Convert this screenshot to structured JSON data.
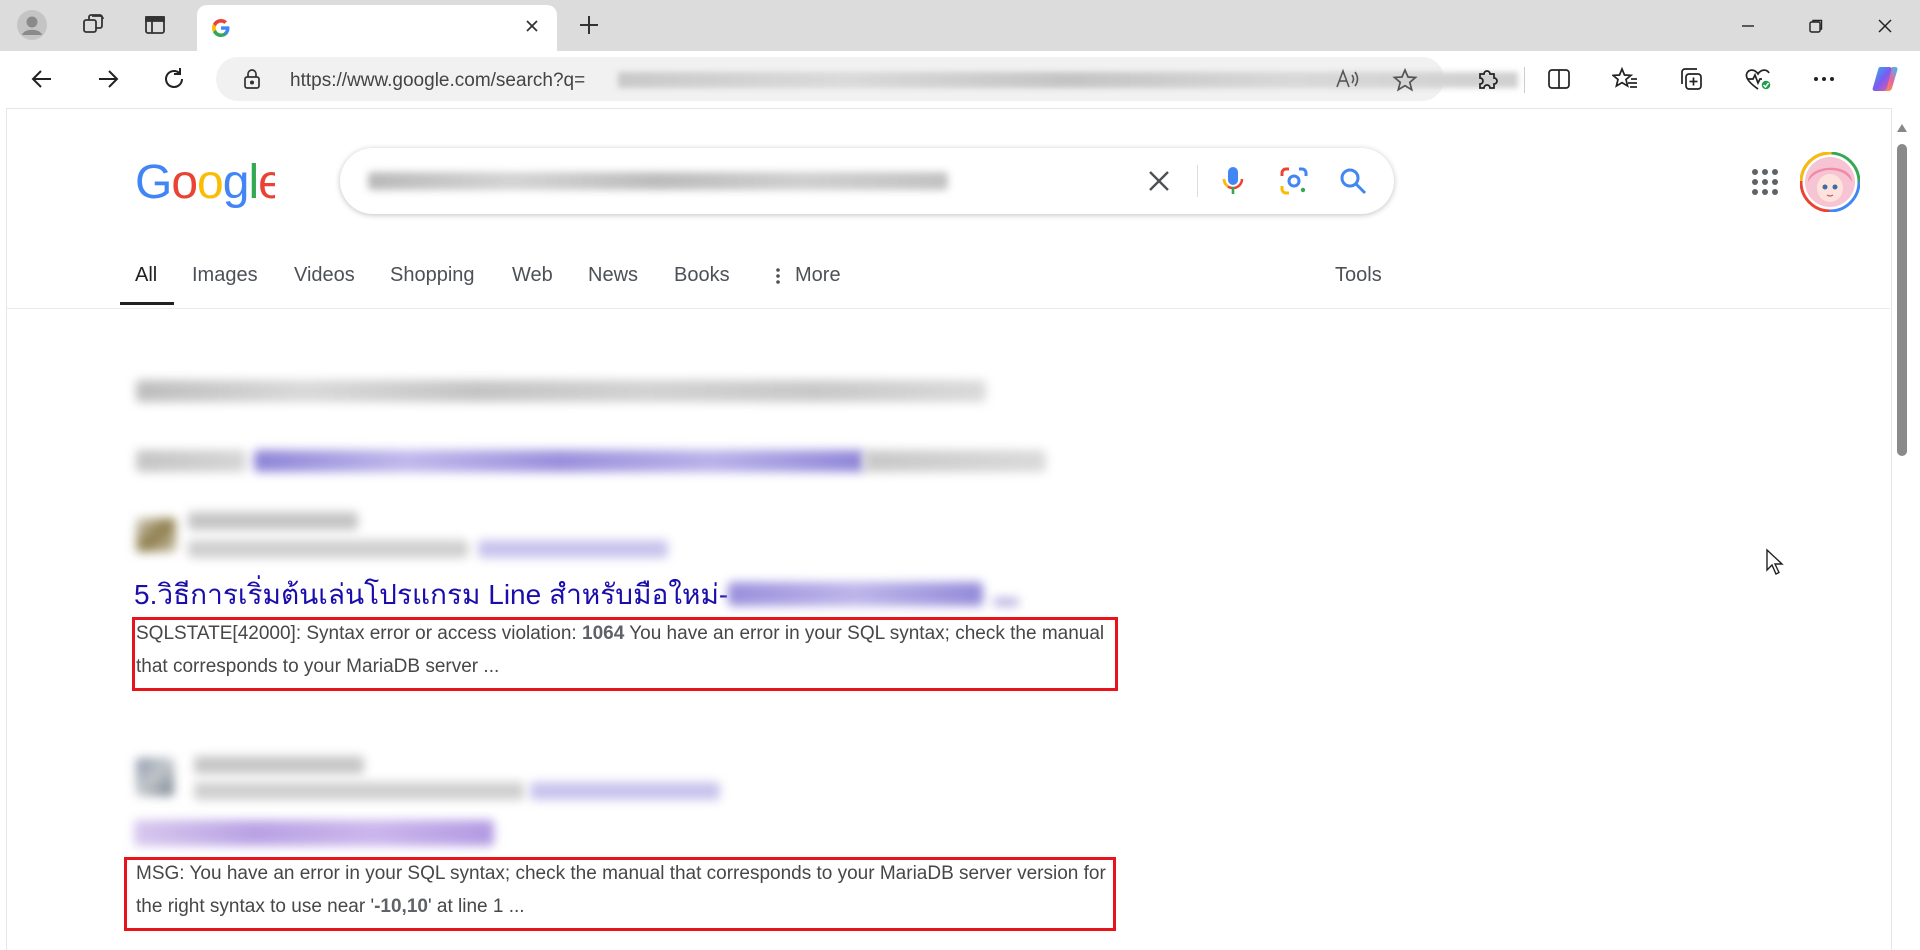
{
  "browser": {
    "tab_title": "",
    "address_url": "https://www.google.com/search?q=",
    "new_tab": "+",
    "icons": [
      "profile-icon",
      "workspaces-icon",
      "tab-actions-icon",
      "google-g-icon",
      "close-icon",
      "minimize-icon",
      "restore-icon",
      "window-close-icon",
      "back-icon",
      "forward-icon",
      "refresh-icon",
      "lock-icon",
      "read-aloud-icon",
      "favorite-star-icon",
      "extensions-icon",
      "split-screen-icon",
      "favorites-icon",
      "collections-icon",
      "browser-essentials-icon",
      "more-icon",
      "copilot-icon"
    ]
  },
  "google": {
    "logo": "Google",
    "search_query": "",
    "nav_tabs": [
      "All",
      "Images",
      "Videos",
      "Shopping",
      "Web",
      "News",
      "Books",
      "More"
    ],
    "tools_label": "Tools"
  },
  "results": {
    "result1": {
      "title": "5.วิธีการเริ่มต้นเล่นโปรแกรม Line สำหรับมือใหม่-",
      "snippet_prefix": "SQLSTATE[42000]: Syntax error or access violation: ",
      "snippet_bold": "1064",
      "snippet_suffix": " You have an error in your SQL syntax; check the manual that corresponds to your MariaDB server ..."
    },
    "result2": {
      "snippet_prefix": "MSG: You have an error in your SQL syntax; check the manual that corresponds to your MariaDB server version for the right syntax to use near '",
      "snippet_bold": "-10,10",
      "snippet_suffix": "' at line 1 ..."
    }
  },
  "colors": {
    "link": "#1a0dab",
    "visited": "#681da8",
    "highlight_box": "#e8141b",
    "google_blue": "#4285f4",
    "google_red": "#ea4335",
    "google_yellow": "#fbbc05",
    "google_green": "#34a853"
  }
}
